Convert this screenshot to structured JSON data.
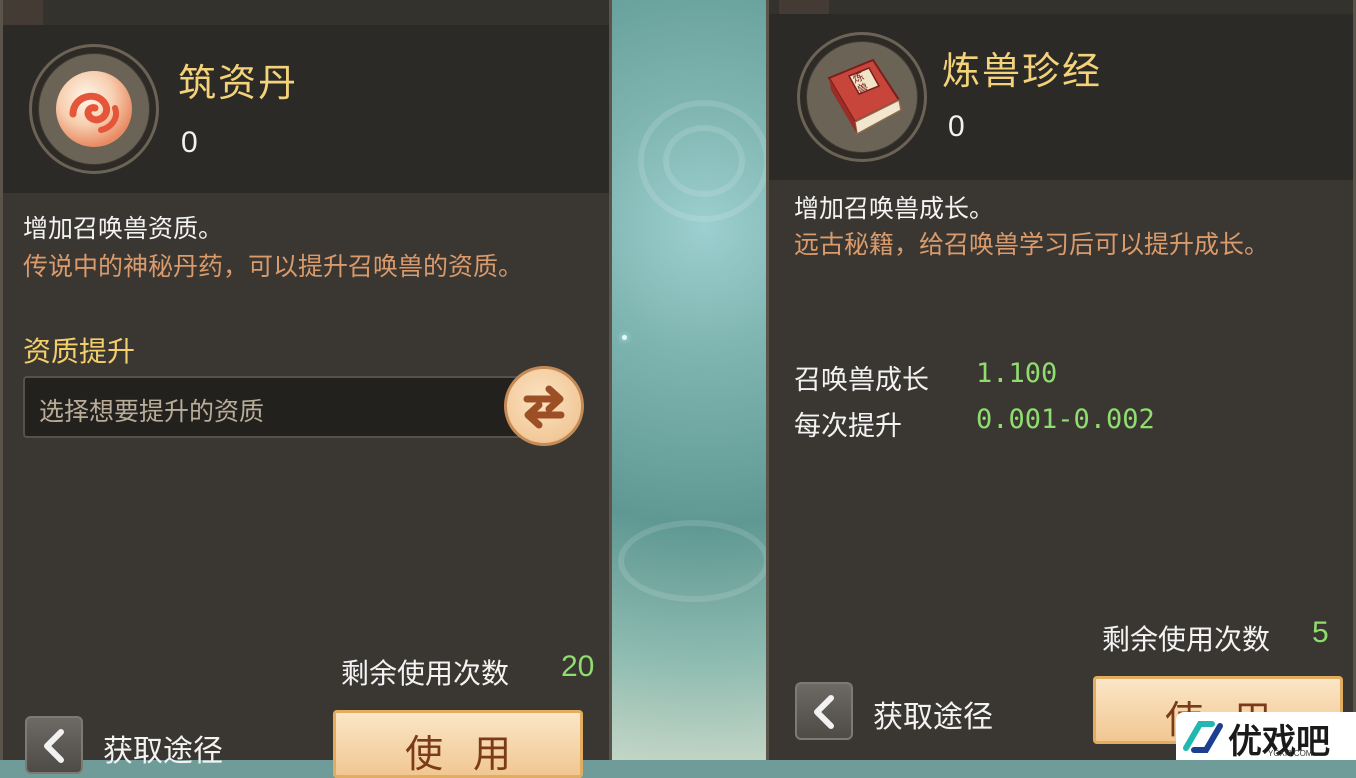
{
  "left_panel": {
    "item_name": "筑资丹",
    "item_count": "0",
    "desc_main": "增加召唤兽资质。",
    "desc_lore": "传说中的神秘丹药，可以提升召唤兽的资质。",
    "section_title": "资质提升",
    "select_placeholder": "选择想要提升的资质",
    "remaining_label": "剩余使用次数",
    "remaining_value": "20",
    "source_label": "获取途径",
    "use_label": "使用"
  },
  "right_panel": {
    "item_name": "炼兽珍经",
    "item_count": "0",
    "book_cover_text": "炼兽",
    "desc_main": "增加召唤兽成长。",
    "desc_lore": "远古秘籍，给召唤兽学习后可以提升成长。",
    "stats": [
      {
        "label": "召唤兽成长",
        "value": "1.100"
      },
      {
        "label": "每次提升",
        "value": "0.001-0.002"
      }
    ],
    "remaining_label": "剩余使用次数",
    "remaining_value": "5",
    "source_label": "获取途径",
    "use_label": "使用"
  },
  "watermark": {
    "name": "优戏吧",
    "domain": "YOXI8.COM"
  },
  "colors": {
    "title_gold": "#f3d27a",
    "lore_orange": "#d99a6c",
    "value_green": "#8fdc6f",
    "panel_bg": "#3a3732"
  },
  "icons": {
    "left_item": "pill-orb-icon",
    "right_item": "book-icon",
    "swap": "swap-arrows-icon",
    "back": "chevron-left-icon"
  }
}
